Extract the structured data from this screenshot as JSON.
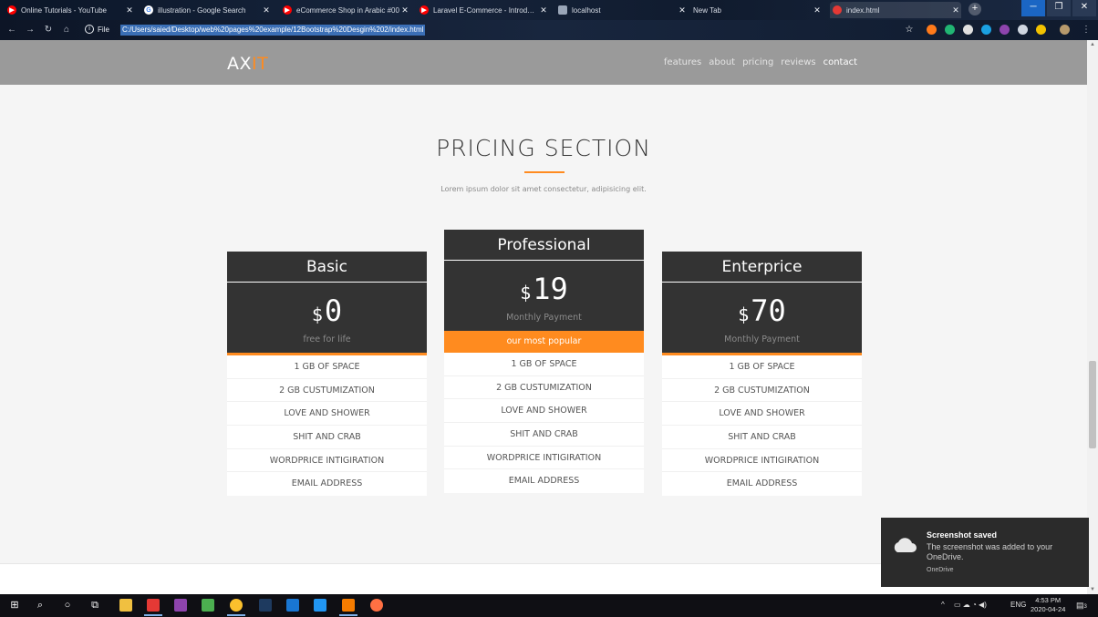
{
  "browser": {
    "tabs": [
      {
        "title": "Online Tutorials - YouTube",
        "icon": "youtube-icon",
        "color": "#ff0000"
      },
      {
        "title": "illustration - Google Search",
        "icon": "google-icon",
        "color": "#4285f4"
      },
      {
        "title": "eCommerce Shop in Arabic #00",
        "icon": "youtube-icon",
        "color": "#ff0000"
      },
      {
        "title": "Laravel E-Commerce - Introducti",
        "icon": "youtube-icon",
        "color": "#ff0000"
      },
      {
        "title": "localhost",
        "icon": "page-icon",
        "color": "#9aa6b8"
      },
      {
        "title": "New Tab",
        "icon": "",
        "color": ""
      },
      {
        "title": "index.html",
        "icon": "file-icon",
        "color": "#e53935"
      }
    ],
    "address": {
      "scheme_label": "File",
      "url": "C:/Users/saied/Desktop/web%20pages%20example/12Bootstrap%20Desgin%202/index.html"
    }
  },
  "site": {
    "logo_main": "AX",
    "logo_accent": "IT",
    "nav": [
      "features",
      "about",
      "pricing",
      "reviews",
      "contact"
    ],
    "active_nav": "contact"
  },
  "pricing": {
    "title": "PRICING SECTION",
    "subtitle": "Lorem ipsum dolor sit amet consectetur, adipisicing elit.",
    "plans": [
      {
        "name": "Basic",
        "currency": "$",
        "price": "0",
        "note": "free for life",
        "badge": "",
        "features": [
          "1 GB OF SPACE",
          "2 GB CUSTUMIZATION",
          "LOVE AND SHOWER",
          "SHIT AND CRAB",
          "WORDPRICE INTIGIRATION",
          "EMAIL ADDRESS"
        ]
      },
      {
        "name": "Professional",
        "currency": "$",
        "price": "19",
        "note": "Monthly Payment",
        "badge": "our most popular",
        "features": [
          "1 GB OF SPACE",
          "2 GB CUSTUMIZATION",
          "LOVE AND SHOWER",
          "SHIT AND CRAB",
          "WORDPRICE INTIGIRATION",
          "EMAIL ADDRESS"
        ]
      },
      {
        "name": "Enterprice",
        "currency": "$",
        "price": "70",
        "note": "Monthly Payment",
        "badge": "",
        "features": [
          "1 GB OF SPACE",
          "2 GB CUSTUMIZATION",
          "LOVE AND SHOWER",
          "SHIT AND CRAB",
          "WORDPRICE INTIGIRATION",
          "EMAIL ADDRESS"
        ]
      }
    ],
    "accent_color": "#ff8b1f",
    "dark_color": "#333333"
  },
  "toast": {
    "title": "Screenshot saved",
    "body": "The screenshot was added to your OneDrive.",
    "source": "OneDrive"
  },
  "taskbar": {
    "lang": "ENG",
    "time": "4:53 PM",
    "date": "2020-04-24",
    "notifications": "3"
  }
}
